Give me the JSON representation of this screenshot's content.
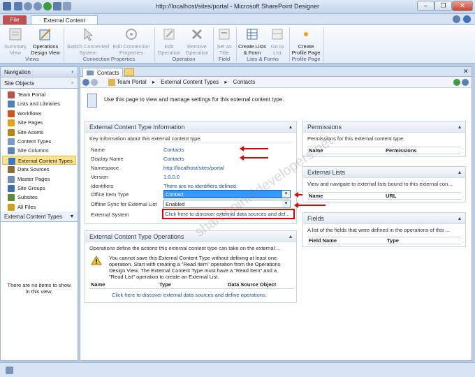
{
  "app": {
    "title": "http://localhost/sites/portal - Microsoft SharePoint Designer",
    "window_buttons": [
      "–",
      "❐",
      "✕"
    ]
  },
  "ribbon": {
    "tabs": [
      "File",
      "External Content Types"
    ],
    "buttons": {
      "summary_view": "Summary View",
      "operations_design_view": "Operations Design View",
      "switch_connected_system": "Switch Connected System",
      "edit_connection_properties": "Edit Connection Properties",
      "edit_operation": "Edit Operation",
      "remove_operation": "Remove Operation",
      "set_as_title": "Set as Title",
      "create_lists_form": "Create Lists & Form",
      "go_to_list": "Go to List",
      "create_profile_page": "Create Profile Page"
    },
    "groups": {
      "views": "Views",
      "connection_properties": "Connection Properties",
      "operation": "Operation",
      "field": "Field",
      "lists_forms": "Lists & Forms",
      "profile_page": "Profile Page"
    }
  },
  "navigation": {
    "header": "Navigation",
    "site_objects_header": "Site Objects",
    "items": [
      {
        "label": "Team Portal",
        "color": "#c0504d"
      },
      {
        "label": "Lists and Libraries",
        "color": "#4f81bd"
      },
      {
        "label": "Workflows",
        "color": "#d0561d"
      },
      {
        "label": "Site Pages",
        "color": "#e3a21a"
      },
      {
        "label": "Site Assets",
        "color": "#b8860b"
      },
      {
        "label": "Content Types",
        "color": "#7a9bc7"
      },
      {
        "label": "Site Columns",
        "color": "#5d84b8"
      },
      {
        "label": "External Content Types",
        "color": "#3a78c2"
      },
      {
        "label": "Data Sources",
        "color": "#8a6d3b"
      },
      {
        "label": "Master Pages",
        "color": "#6e8fb7"
      },
      {
        "label": "Site Groups",
        "color": "#3d6fa8"
      },
      {
        "label": "Subsites",
        "color": "#5a8a3a"
      },
      {
        "label": "All Files",
        "color": "#d4a017"
      }
    ],
    "ect_header": "External Content Types",
    "empty_text": "There are no items to show in this view."
  },
  "document": {
    "tab": "Contacts",
    "breadcrumb": [
      "Team Portal",
      "External Content Types",
      "Contacts"
    ],
    "intro": "Use this page to view and manage settings for this external content type."
  },
  "info_panel": {
    "title": "External Content Type Information",
    "subtitle": "Key information about this external content type.",
    "rows": {
      "name_label": "Name",
      "name_value": "Contacts",
      "display_name_label": "Display Name",
      "display_name_value": "Contacts",
      "namespace_label": "Namespace",
      "namespace_value": "http://localhost/sites/portal",
      "version_label": "Version",
      "version_value": "1.0.0.0",
      "identifiers_label": "Identifiers",
      "identifiers_value": "There are no identifiers defined.",
      "office_item_type_label": "Office Item Type",
      "office_item_type_value": "Contact",
      "offline_sync_label": "Offline Sync for External List",
      "offline_sync_value": "Enabled",
      "external_system_label": "External System",
      "external_system_value": "Click here to discover external data sources and def..."
    }
  },
  "operations_panel": {
    "title": "External Content Type Operations",
    "subtitle": "Operations define the actions this external content type can take on the external ...",
    "warning": "You cannot save this External Content Type without defining at least one operation. Start with creating a \"Read Item\" operation from the Operations Design View. The External Content Type must have a \"Read Item\" and a \"Read List\" operation to create an External List.",
    "columns": [
      "Name",
      "Type",
      "Data Source Object"
    ],
    "discover_link": "Click here to discover external data sources and define operations."
  },
  "permissions_panel": {
    "title": "Permissions",
    "subtitle": "Permissions for this external content type.",
    "columns": [
      "Name",
      "Permissions"
    ]
  },
  "external_lists_panel": {
    "title": "External Lists",
    "subtitle": "View and navigate to external lists bound to this external con...",
    "columns": [
      "Name",
      "URL"
    ]
  },
  "fields_panel": {
    "title": "Fields",
    "subtitle": "A list of the fields that were defined in the operations of this ...",
    "columns": [
      "Field Name",
      "Type"
    ]
  },
  "watermark": "sharepoint4developers.net",
  "colors": {
    "accent": "#1a4e9a",
    "annotation": "#e00000",
    "selected": "#ffe38c"
  }
}
